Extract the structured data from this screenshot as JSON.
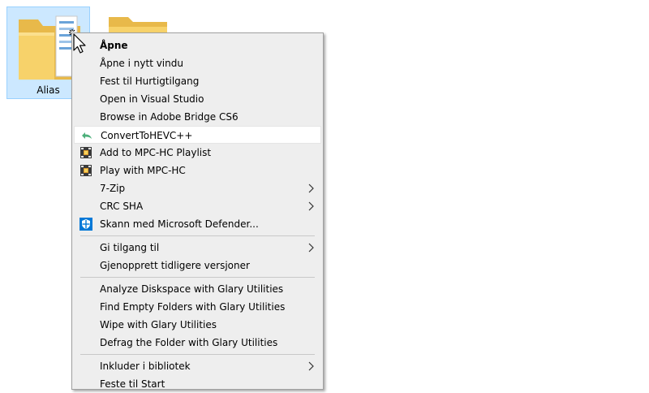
{
  "desktop": {
    "icons": [
      {
        "label": "Alias",
        "icon": "folder-icon",
        "selected": true
      },
      {
        "label": "",
        "icon": "folder-icon",
        "selected": false
      }
    ]
  },
  "menu": {
    "items": [
      {
        "label": "Åpne",
        "bold": true
      },
      {
        "label": "Åpne i nytt vindu"
      },
      {
        "label": "Fest til Hurtigtilgang"
      },
      {
        "label": "Open in Visual Studio"
      },
      {
        "label": "Browse in Adobe Bridge CS6"
      },
      {
        "label": "ConvertToHEVC++",
        "icon": "undo-arrow-icon",
        "highlighted": true
      },
      {
        "label": "Add to MPC-HC Playlist",
        "icon": "mpc-hc-icon"
      },
      {
        "label": "Play with MPC-HC",
        "icon": "mpc-hc-icon"
      },
      {
        "label": "7-Zip",
        "submenu": true
      },
      {
        "label": "CRC SHA",
        "submenu": true
      },
      {
        "label": "Skann med Microsoft Defender...",
        "icon": "defender-shield-icon"
      },
      {
        "label": "Gi tilgang til",
        "submenu": true
      },
      {
        "label": "Gjenopprett tidligere versjoner"
      },
      {
        "label": "Analyze Diskspace with Glary Utilities"
      },
      {
        "label": "Find Empty Folders with Glary Utilities"
      },
      {
        "label": "Wipe with Glary Utilities"
      },
      {
        "label": "Defrag the Folder with Glary Utilities"
      },
      {
        "label": "Inkluder i bibliotek",
        "submenu": true
      },
      {
        "label": "Feste til Start"
      }
    ]
  },
  "colors": {
    "selection_bg": "#cce8ff",
    "menu_bg": "#eeeeee",
    "highlight_bg": "#ffffff",
    "defender_blue": "#0078d7",
    "undo_green": "#4caf7a"
  }
}
